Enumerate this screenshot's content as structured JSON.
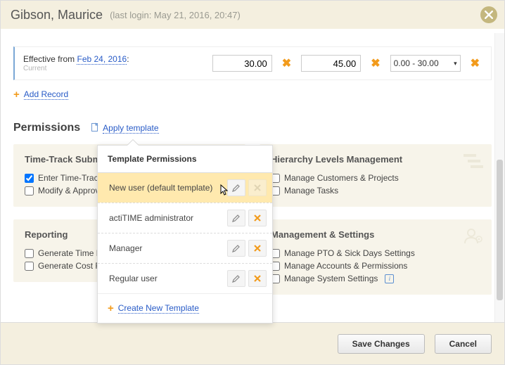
{
  "header": {
    "user_name": "Gibson, Maurice",
    "last_login": "(last login: May 21, 2016, 20:47)"
  },
  "record": {
    "effective_label": "Effective from ",
    "date": "Feb 24, 2016",
    "date_suffix": ":",
    "current_label": "Current",
    "val1": "30.00",
    "val2": "45.00",
    "range": "0.00 - 30.00"
  },
  "add_record_label": "Add Record",
  "section": {
    "title": "Permissions",
    "apply_link": "Apply template"
  },
  "cards": {
    "tts": {
      "title": "Time-Track Submission",
      "row1": "Enter Time-Track",
      "row2": "Modify & Approve"
    },
    "hier": {
      "title": "Hierarchy Levels Management",
      "row1": "Manage Customers & Projects",
      "row2": "Manage Tasks"
    },
    "rep": {
      "title": "Reporting",
      "row1": "Generate Time Reports",
      "row2": "Generate Cost Reports"
    },
    "mgmt": {
      "title": "Management & Settings",
      "row1": "Manage PTO & Sick Days Settings",
      "row2": "Manage Accounts & Permissions",
      "row3": "Manage System Settings"
    }
  },
  "popover": {
    "title": "Template Permissions",
    "items": {
      "0": "New user (default template)",
      "1": "actiTIME administrator",
      "2": "Manager",
      "3": "Regular user"
    },
    "create": "Create New Template"
  },
  "footer": {
    "save": "Save Changes",
    "cancel": "Cancel"
  }
}
